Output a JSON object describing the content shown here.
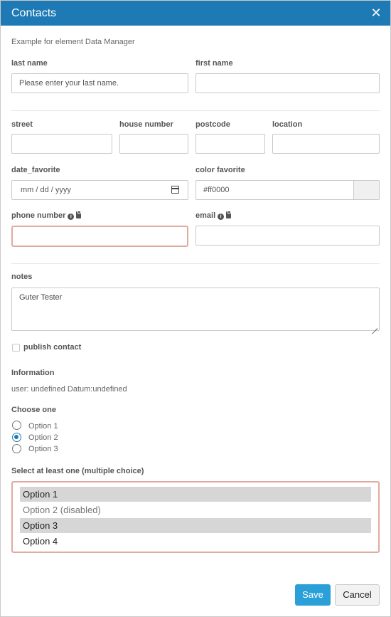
{
  "window": {
    "title": "Contacts",
    "close_glyph": "✕"
  },
  "description": "Example for element Data Manager",
  "fields": {
    "last_name": {
      "label": "last name",
      "value": "",
      "placeholder": "Please enter your last name."
    },
    "first_name": {
      "label": "first name",
      "value": "",
      "placeholder": ""
    },
    "street": {
      "label": "street",
      "value": ""
    },
    "house_number": {
      "label": "house number",
      "value": ""
    },
    "postcode": {
      "label": "postcode",
      "value": ""
    },
    "location": {
      "label": "location",
      "value": ""
    },
    "date_favorite": {
      "label": "date_favorite",
      "value": "mm / dd / yyyy"
    },
    "color_favorite": {
      "label": "color favorite",
      "value": "#ff0000"
    },
    "phone_number": {
      "label": "phone number",
      "value": ""
    },
    "email": {
      "label": "email",
      "value": ""
    },
    "notes": {
      "label": "notes",
      "value": "Guter Tester"
    }
  },
  "publish": {
    "label": "publish contact",
    "checked": false
  },
  "information": {
    "label": "Information",
    "text": "user: undefined Datum:undefined"
  },
  "choose_one": {
    "label": "Choose one",
    "options": [
      "Option 1",
      "Option 2",
      "Option 3"
    ],
    "selected": "Option 2"
  },
  "multi_select": {
    "label": "Select at least one (multiple choice)",
    "options": [
      "Option 1",
      "Option 2 (disabled)",
      "Option 3",
      "Option 4"
    ],
    "selected": [
      "Option 1",
      "Option 3"
    ],
    "disabled": [
      "Option 2 (disabled)"
    ]
  },
  "buttons": {
    "save": "Save",
    "cancel": "Cancel"
  },
  "icons": {
    "info": "info-icon",
    "clipboard": "clipboard-icon",
    "calendar": "calendar-icon",
    "close": "close-icon"
  },
  "colors": {
    "titlebar": "#1e7ab5",
    "save_button": "#2a9fd8",
    "error_border": "#e0aaa0",
    "selected_option": "#d6d6d6"
  }
}
